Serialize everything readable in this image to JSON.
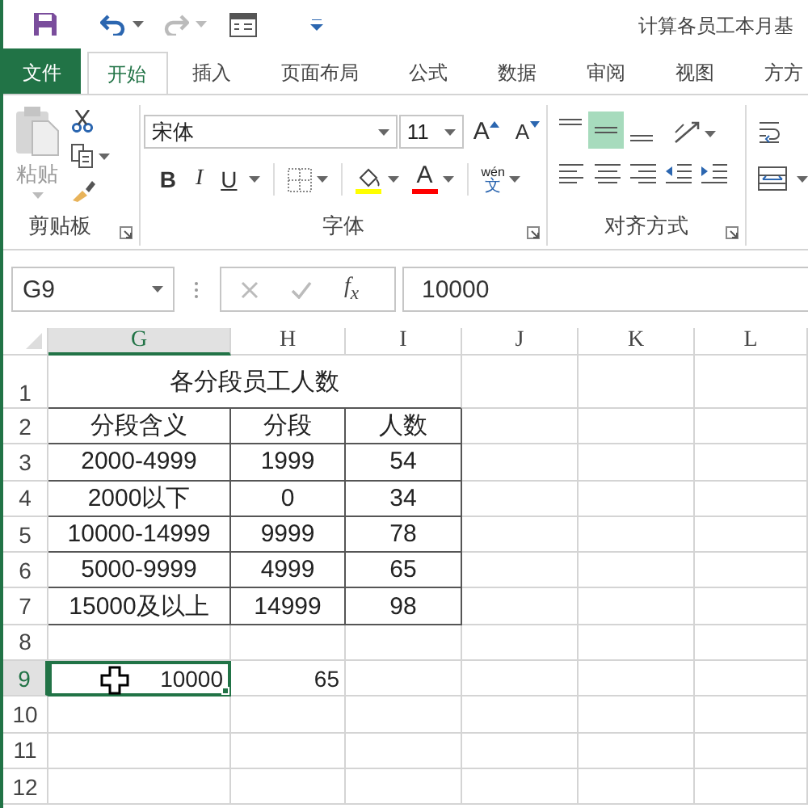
{
  "window": {
    "title": "计算各员工本月基"
  },
  "tabs": [
    {
      "label": "文件",
      "kind": "file",
      "selected": false
    },
    {
      "label": "开始",
      "kind": "tab",
      "selected": true
    },
    {
      "label": "插入",
      "kind": "tab",
      "selected": false
    },
    {
      "label": "页面布局",
      "kind": "tab",
      "selected": false
    },
    {
      "label": "公式",
      "kind": "tab",
      "selected": false
    },
    {
      "label": "数据",
      "kind": "tab",
      "selected": false
    },
    {
      "label": "审阅",
      "kind": "tab",
      "selected": false
    },
    {
      "label": "视图",
      "kind": "tab",
      "selected": false
    },
    {
      "label": "方方",
      "kind": "tab",
      "selected": false
    }
  ],
  "ribbon": {
    "clipboard": {
      "label": "剪贴板",
      "paste": "粘贴"
    },
    "font": {
      "label": "字体",
      "name": "宋体",
      "size": "11",
      "grow": "A",
      "shrink": "A",
      "bold": "B",
      "italic": "I",
      "underline": "U",
      "font_color": "A",
      "phonetic_top": "wén",
      "phonetic_bottom": "文"
    },
    "alignment": {
      "label": "对齐方式",
      "vertical": [
        {
          "kind": "top",
          "selected": false
        },
        {
          "kind": "middle",
          "selected": true
        },
        {
          "kind": "bottom",
          "selected": false
        }
      ]
    }
  },
  "formula_bar": {
    "name_box": "G9",
    "function_label": "f$_{x}$",
    "value": "10000"
  },
  "sheet": {
    "columns": [
      {
        "label": "G",
        "selected": true
      },
      {
        "label": "H",
        "selected": false
      },
      {
        "label": "I",
        "selected": false
      },
      {
        "label": "J",
        "selected": false
      },
      {
        "label": "K",
        "selected": false
      },
      {
        "label": "L",
        "selected": false
      }
    ],
    "rows": [
      {
        "header": "1",
        "selected": false,
        "kind": "title",
        "title": "各分段员工人数"
      },
      {
        "header": "2",
        "selected": false,
        "kind": "table",
        "cells": [
          "分段含义",
          "分段",
          "人数"
        ]
      },
      {
        "header": "3",
        "selected": false,
        "kind": "table",
        "cells": [
          "2000-4999",
          "1999",
          "54"
        ]
      },
      {
        "header": "4",
        "selected": false,
        "kind": "table",
        "cells": [
          "2000以下",
          "0",
          "34"
        ]
      },
      {
        "header": "5",
        "selected": false,
        "kind": "table",
        "cells": [
          "10000-14999",
          "9999",
          "78"
        ]
      },
      {
        "header": "6",
        "selected": false,
        "kind": "table",
        "cells": [
          "5000-9999",
          "4999",
          "65"
        ]
      },
      {
        "header": "7",
        "selected": false,
        "kind": "table",
        "cells": [
          "15000及以上",
          "14999",
          "98"
        ]
      },
      {
        "header": "8",
        "selected": false,
        "kind": "blank"
      },
      {
        "header": "9",
        "selected": true,
        "kind": "values",
        "cells": [
          "10000",
          "65"
        ]
      },
      {
        "header": "10",
        "selected": false,
        "kind": "blank"
      },
      {
        "header": "11",
        "selected": false,
        "kind": "blank"
      },
      {
        "header": "12",
        "selected": false,
        "kind": "blank"
      }
    ]
  }
}
